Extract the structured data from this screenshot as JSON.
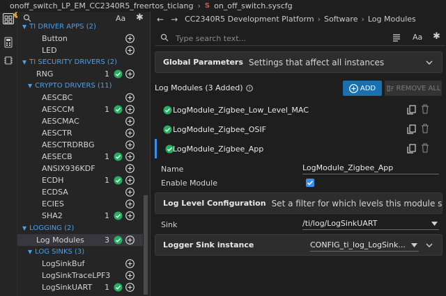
{
  "titlebar": {
    "project": "onoff_switch_LP_EM_CC2340R5_freertos_ticlang",
    "file": "on_off_switch.syscfg"
  },
  "sidebar": {
    "search_aa": "Aa",
    "categories": [
      {
        "label": "TI DRIVER APPS (2)"
      },
      {
        "label": "TI SECURITY DRIVERS (2)"
      },
      {
        "label": "CRYPTO DRIVERS (11)"
      },
      {
        "label": "LOGGING (2)"
      },
      {
        "label": "LOG SINKS (3)"
      }
    ],
    "items": [
      {
        "label": "Button",
        "count": ""
      },
      {
        "label": "LED",
        "count": ""
      },
      {
        "label": "RNG",
        "count": "1"
      },
      {
        "label": "AESCBC",
        "count": ""
      },
      {
        "label": "AESCCM",
        "count": "1"
      },
      {
        "label": "AESCMAC",
        "count": ""
      },
      {
        "label": "AESCTR",
        "count": ""
      },
      {
        "label": "AESCTRDRBG",
        "count": ""
      },
      {
        "label": "AESECB",
        "count": "1"
      },
      {
        "label": "ANSIX936KDF",
        "count": ""
      },
      {
        "label": "ECDH",
        "count": "1"
      },
      {
        "label": "ECDSA",
        "count": ""
      },
      {
        "label": "ECIES",
        "count": ""
      },
      {
        "label": "SHA2",
        "count": "1"
      },
      {
        "label": "Log Modules",
        "count": "3"
      },
      {
        "label": "LogSinkBuf",
        "count": ""
      },
      {
        "label": "LogSinkTraceLPF3",
        "count": ""
      },
      {
        "label": "LogSinkUART",
        "count": "1"
      }
    ]
  },
  "main": {
    "breadcrumb": [
      "CC2340R5 Development Platform",
      "Software",
      "Log Modules"
    ],
    "search_placeholder": "Type search text...",
    "search_aa": "Aa",
    "global": {
      "title": "Global Parameters",
      "desc": "Settings that affect all instances"
    },
    "log_modules_header": "Log Modules (3 Added)",
    "add_label": "ADD",
    "remove_all_label": "REMOVE ALL",
    "modules": [
      {
        "name": "LogModule_Zigbee_Low_Level_MAC"
      },
      {
        "name": "LogModule_Zigbee_OSIF"
      },
      {
        "name": "LogModule_Zigbee_App"
      }
    ],
    "name_label": "Name",
    "name_value": "LogModule_Zigbee_App",
    "enable_label": "Enable Module",
    "log_level": {
      "title": "Log Level Configuration",
      "desc": "Set a filter for which levels this module should generate"
    },
    "sink_label": "Sink",
    "sink_value": "/ti/log/LogSinkUART",
    "logger_sink": {
      "title": "Logger Sink instance",
      "value": "CONFIG_ti_log_LogSink..."
    }
  },
  "colors": {
    "accent": "#1b6fad",
    "check": "#27ae60",
    "category": "#4e9fe6"
  }
}
